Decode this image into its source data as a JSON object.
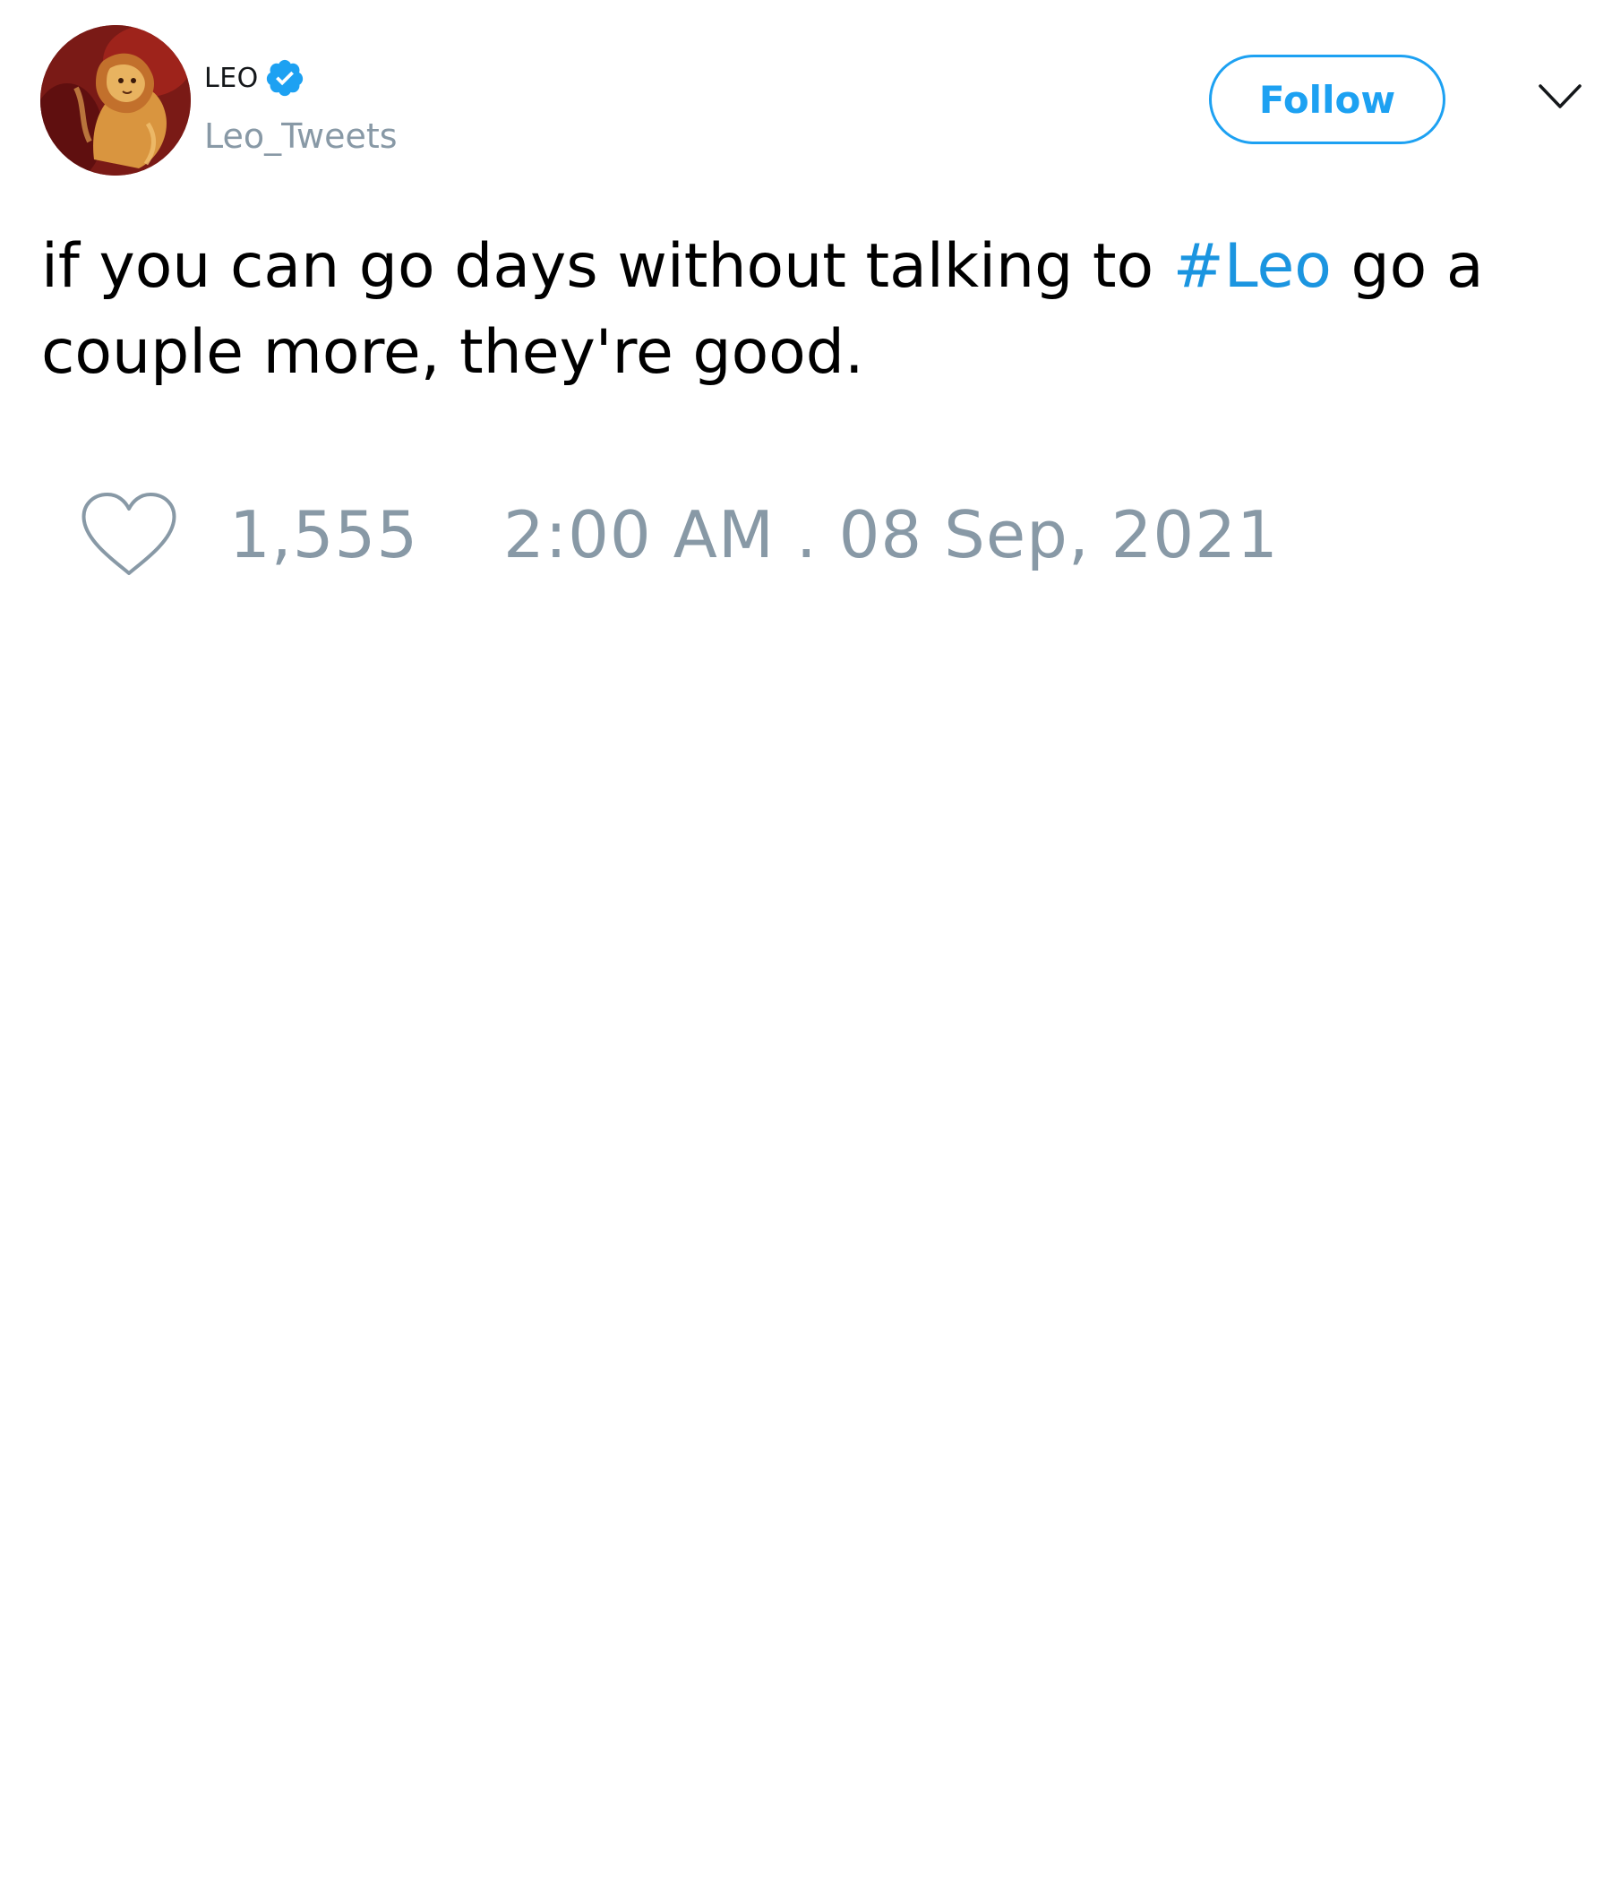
{
  "tweet": {
    "author": {
      "display_name": "LEO",
      "handle": "Leo_Tweets",
      "verified": true,
      "avatar_icon": "lion-avatar-image"
    },
    "follow_label": "Follow",
    "menu_icon": "chevron-down-icon",
    "text_before": "if you can go days without talking to ",
    "hashtag": "#Leo",
    "text_after": " go a couple more, they're good.",
    "like_icon": "heart-outline-icon",
    "like_count": "1,555",
    "timestamp": "2:00 AM . 08 Sep, 2021"
  },
  "colors": {
    "accent": "#1da1f2",
    "hashtag": "#1b95e0",
    "muted": "#8899a6",
    "text": "#000000"
  }
}
